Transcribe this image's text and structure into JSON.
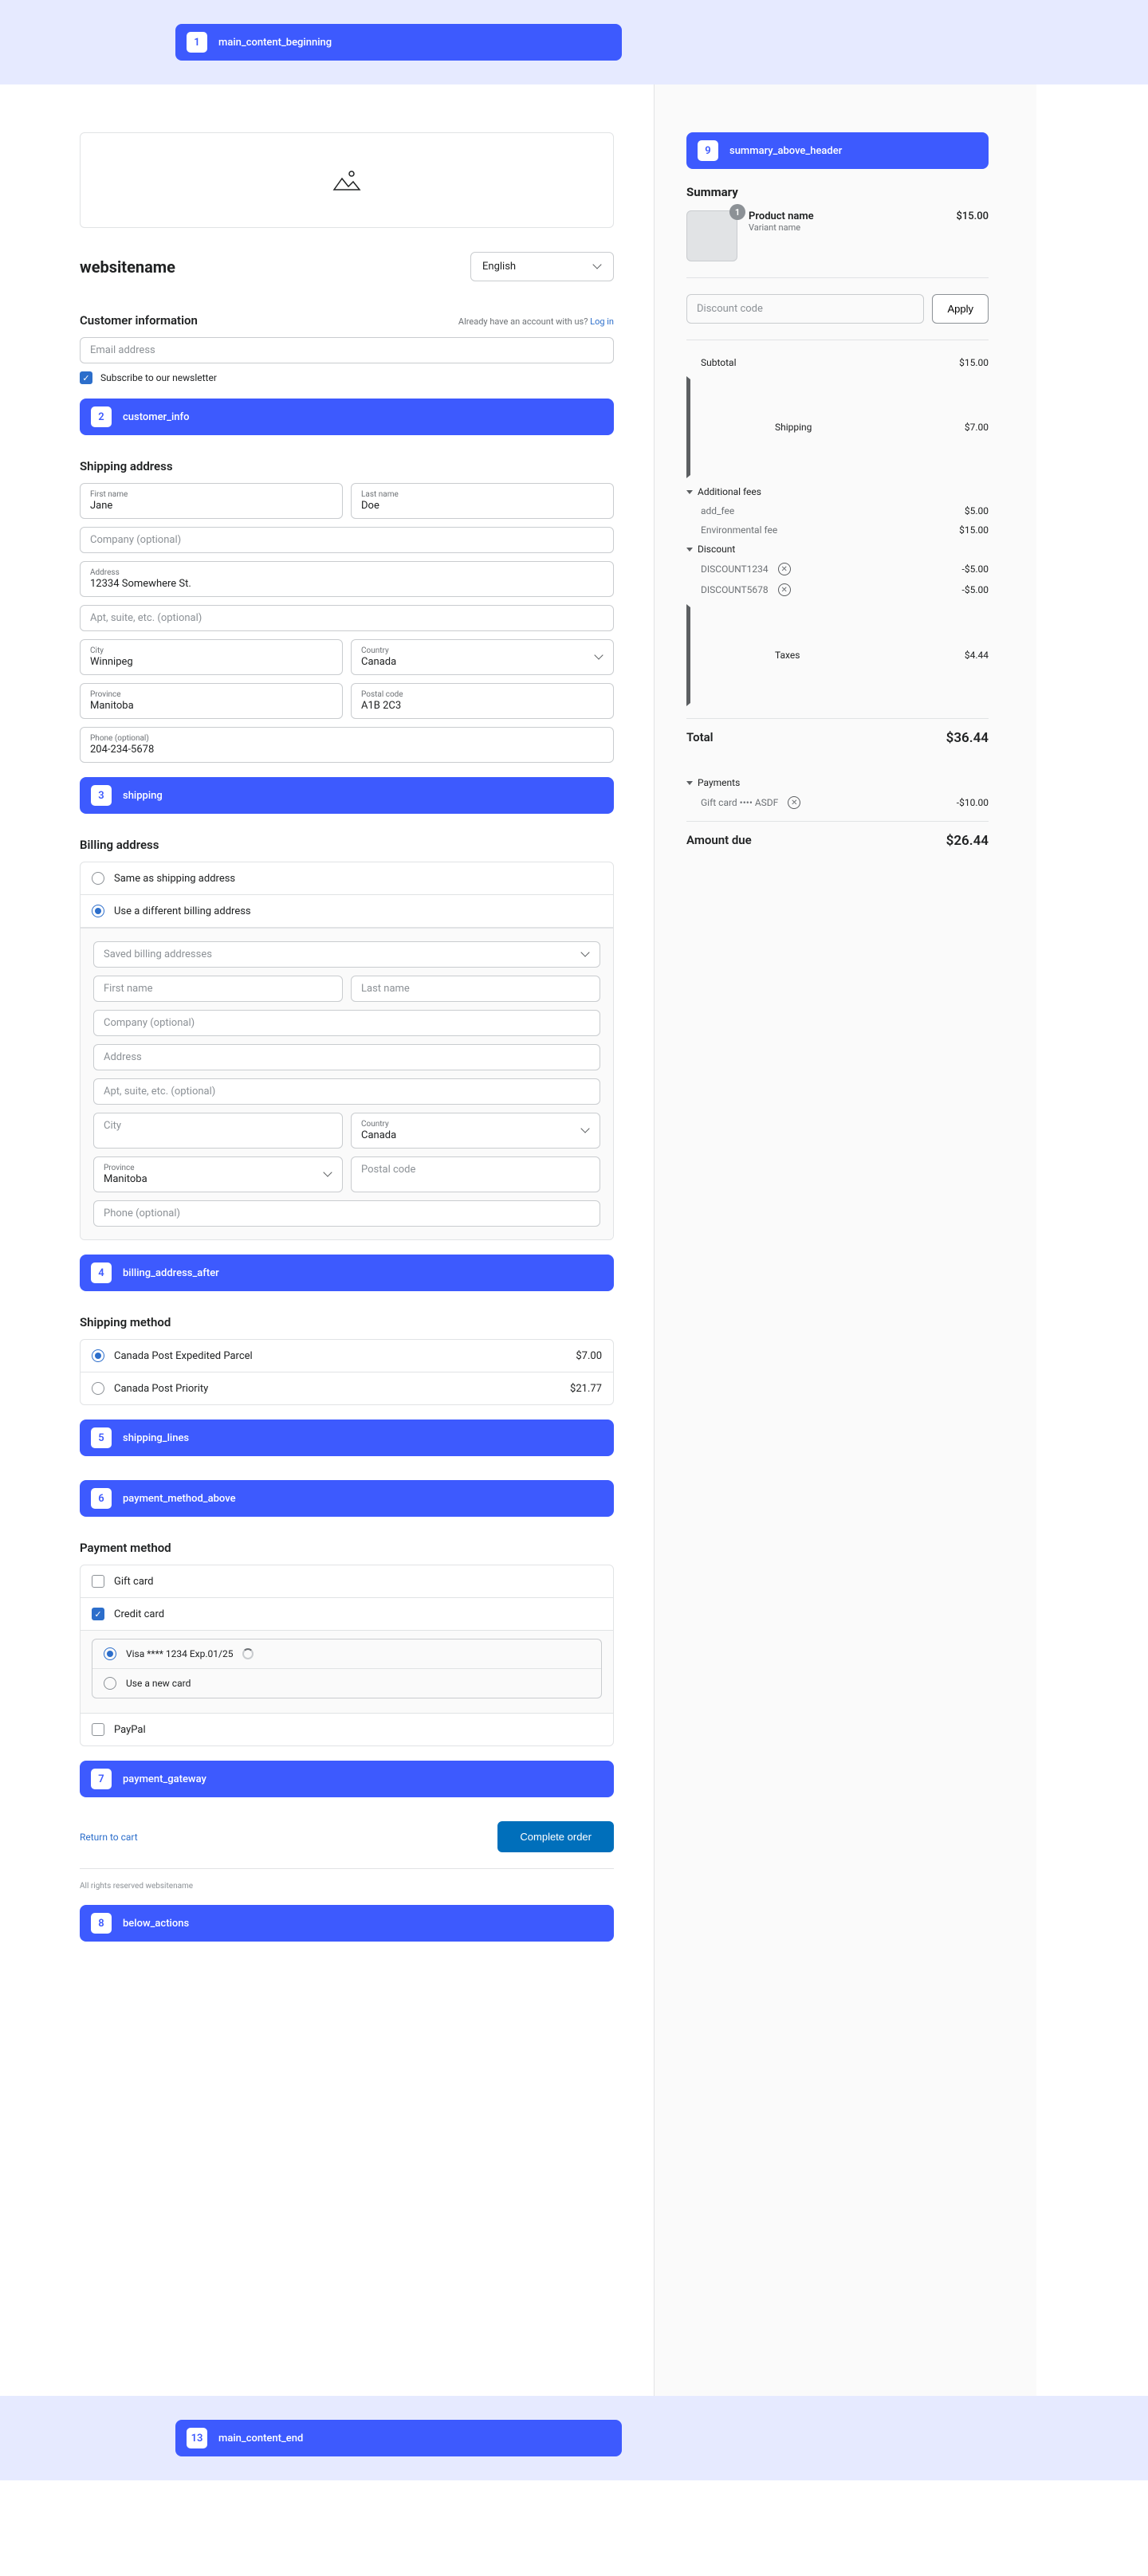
{
  "slots": {
    "s1": {
      "num": "1",
      "label": "main_content_beginning"
    },
    "s2": {
      "num": "2",
      "label": "customer_info"
    },
    "s3": {
      "num": "3",
      "label": "shipping"
    },
    "s4": {
      "num": "4",
      "label": "billing_address_after"
    },
    "s5": {
      "num": "5",
      "label": "shipping_lines"
    },
    "s6": {
      "num": "6",
      "label": "payment_method_above"
    },
    "s7": {
      "num": "7",
      "label": "payment_gateway"
    },
    "s8": {
      "num": "8",
      "label": "below_actions"
    },
    "s9": {
      "num": "9",
      "label": "summary_above_header"
    },
    "s13": {
      "num": "13",
      "label": "main_content_end"
    }
  },
  "header": {
    "site_name": "websitename",
    "language": "English"
  },
  "customer": {
    "title": "Customer information",
    "account_prompt": "Already have an account with us? ",
    "login": "Log in",
    "email_ph": "Email address",
    "newsletter": "Subscribe to our newsletter"
  },
  "shipping_addr": {
    "title": "Shipping address",
    "first_name_lbl": "First name",
    "first_name": "Jane",
    "last_name_lbl": "Last name",
    "last_name": "Doe",
    "company_ph": "Company (optional)",
    "address_lbl": "Address",
    "address": "12334 Somewhere St.",
    "apt_ph": "Apt, suite, etc. (optional)",
    "city_lbl": "City",
    "city": "Winnipeg",
    "country_lbl": "Country",
    "country": "Canada",
    "province_lbl": "Province",
    "province": "Manitoba",
    "postal_lbl": "Postal code",
    "postal": "A1B 2C3",
    "phone_lbl": "Phone (optional)",
    "phone": "204-234-5678"
  },
  "billing": {
    "title": "Billing address",
    "same": "Same as shipping address",
    "different": "Use a different billing address",
    "saved_ph": "Saved billing addresses",
    "first_name_ph": "First name",
    "last_name_ph": "Last name",
    "company_ph": "Company (optional)",
    "address_ph": "Address",
    "apt_ph": "Apt, suite, etc. (optional)",
    "city_ph": "City",
    "country_lbl": "Country",
    "country": "Canada",
    "province_lbl": "Province",
    "province": "Manitoba",
    "postal_ph": "Postal code",
    "phone_ph": "Phone (optional)"
  },
  "ship_method": {
    "title": "Shipping method",
    "opt1": {
      "name": "Canada Post Expedited Parcel",
      "price": "$7.00"
    },
    "opt2": {
      "name": "Canada Post Priority",
      "price": "$21.77"
    }
  },
  "payment": {
    "title": "Payment method",
    "gift": "Gift card",
    "credit": "Credit card",
    "saved_card": "Visa **** 1234 Exp.01/25",
    "new_card": "Use a new card",
    "paypal": "PayPal"
  },
  "actions": {
    "return": "Return to cart",
    "complete": "Complete order"
  },
  "footer": "All rights reserved websitename",
  "summary": {
    "title": "Summary",
    "product": {
      "name": "Product name",
      "variant": "Variant name",
      "price": "$15.00",
      "qty": "1"
    },
    "discount_ph": "Discount code",
    "apply": "Apply",
    "subtotal": {
      "label": "Subtotal",
      "value": "$15.00"
    },
    "shipping": {
      "label": "Shipping",
      "value": "$7.00"
    },
    "fees": {
      "label": "Additional fees"
    },
    "fee1": {
      "label": "add_fee",
      "value": "$5.00"
    },
    "fee2": {
      "label": "Environmental fee",
      "value": "$15.00"
    },
    "discount": {
      "label": "Discount"
    },
    "disc1": {
      "label": "DISCOUNT1234",
      "value": "-$5.00"
    },
    "disc2": {
      "label": "DISCOUNT5678",
      "value": "-$5.00"
    },
    "taxes": {
      "label": "Taxes",
      "value": "$4.44"
    },
    "total": {
      "label": "Total",
      "value": "$36.44"
    },
    "payments": {
      "label": "Payments"
    },
    "gc": {
      "label": "Gift card •••• ASDF",
      "value": "-$10.00"
    },
    "due": {
      "label": "Amount due",
      "value": "$26.44"
    }
  }
}
